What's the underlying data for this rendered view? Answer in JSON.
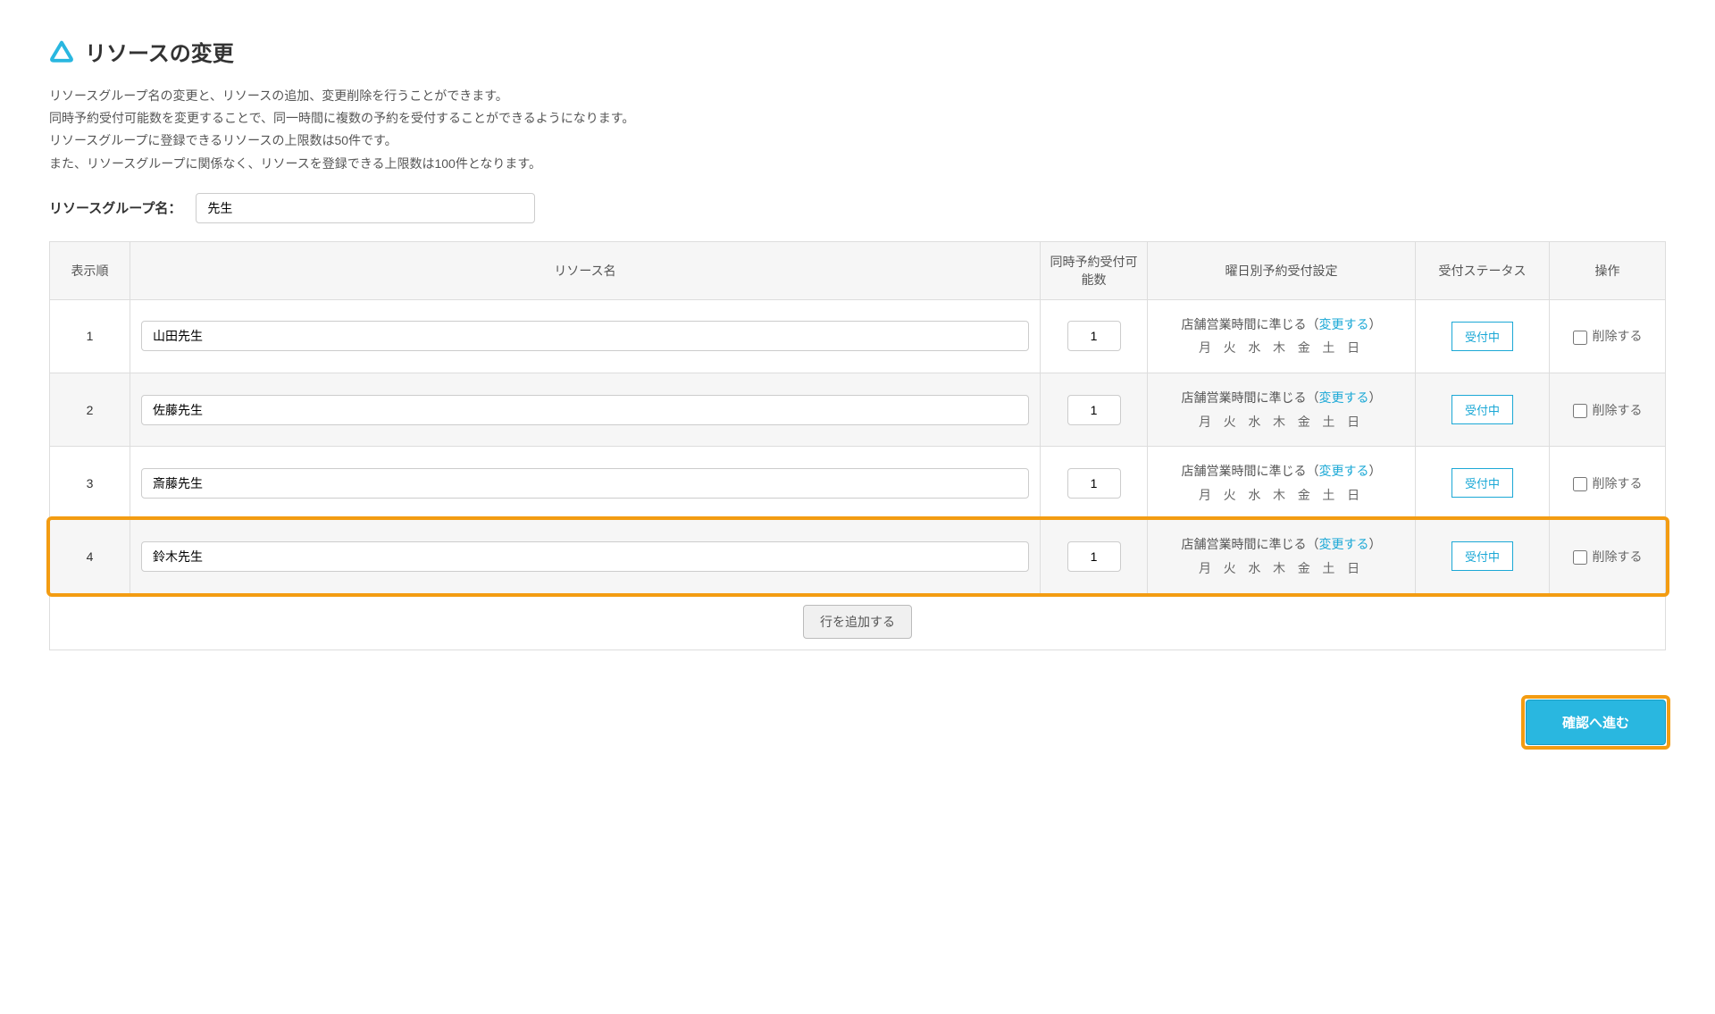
{
  "header": {
    "title": "リソースの変更"
  },
  "description": {
    "line1": "リソースグループ名の変更と、リソースの追加、変更削除を行うことができます。",
    "line2": "同時予約受付可能数を変更することで、同一時間に複数の予約を受付することができるようになります。",
    "line3": "リソースグループに登録できるリソースの上限数は50件です。",
    "line4": "また、リソースグループに関係なく、リソースを登録できる上限数は100件となります。"
  },
  "group": {
    "label": "リソースグループ名：",
    "value": "先生"
  },
  "table": {
    "headers": {
      "order": "表示順",
      "name": "リソース名",
      "count": "同時予約受付可能数",
      "schedule": "曜日別予約受付設定",
      "status": "受付ステータス",
      "action": "操作"
    },
    "schedule_text": "店舗営業時間に準じる（",
    "change_link": "変更する",
    "schedule_close": "）",
    "days": "月 火 水 木 金 土 日",
    "status_label": "受付中",
    "delete_label": "削除する",
    "rows": [
      {
        "order": "1",
        "name": "山田先生",
        "count": "1"
      },
      {
        "order": "2",
        "name": "佐藤先生",
        "count": "1"
      },
      {
        "order": "3",
        "name": "斎藤先生",
        "count": "1"
      },
      {
        "order": "4",
        "name": "鈴木先生",
        "count": "1"
      }
    ]
  },
  "buttons": {
    "add_row": "行を追加する",
    "confirm": "確認へ進む"
  }
}
